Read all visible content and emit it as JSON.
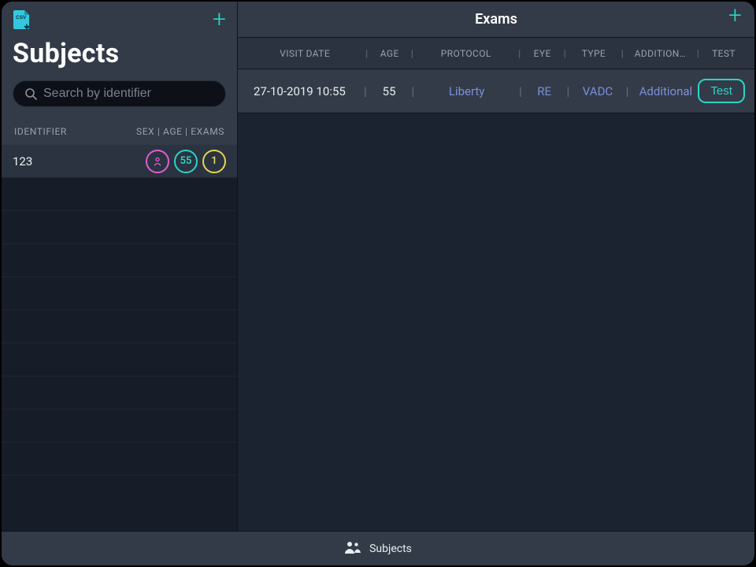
{
  "sidebar": {
    "title": "Subjects",
    "search_placeholder": "Search by identifier",
    "columns": {
      "identifier": "IDENTIFIER",
      "right": "SEX | AGE | EXAMS"
    }
  },
  "subjects": [
    {
      "identifier": "123",
      "age": "55",
      "exams": "1"
    }
  ],
  "main": {
    "title": "Exams",
    "columns": {
      "visit_date": "VISIT DATE",
      "age": "AGE",
      "protocol": "PROTOCOL",
      "eye": "EYE",
      "type": "TYPE",
      "additional": "ADDITION…",
      "test": "TEST"
    }
  },
  "exams": [
    {
      "visit_date": "27-10-2019 10:55",
      "age": "55",
      "protocol": "Liberty",
      "eye": "RE",
      "type": "VADC",
      "additional": "Additional",
      "test_label": "Test"
    }
  ],
  "footer": {
    "label": "Subjects"
  }
}
